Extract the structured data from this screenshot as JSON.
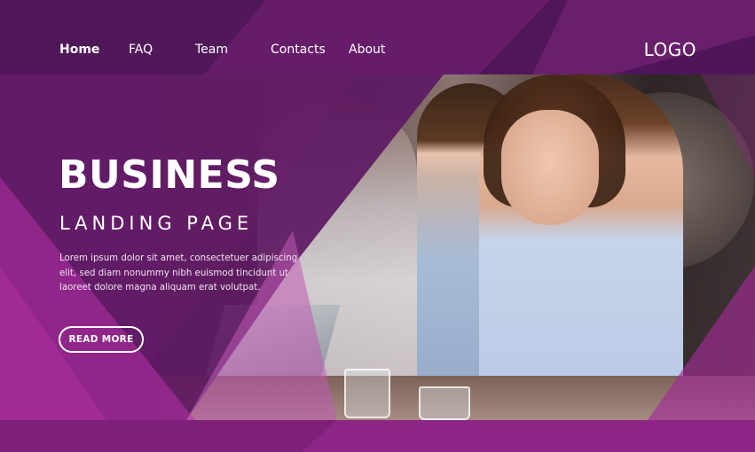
{
  "nav": {
    "items": [
      {
        "label": "Home",
        "active": true
      },
      {
        "label": "FAQ"
      },
      {
        "label": "Team"
      },
      {
        "label": "Contacts"
      },
      {
        "label": "About"
      }
    ],
    "logo": "LOGO"
  },
  "hero": {
    "title": "BUSINESS",
    "subtitle": "LANDING PAGE",
    "body": "Lorem ipsum dolor sit amet, consectetuer adipiscing elit, sed diam nonummy nibh euismod tincidunt ut laoreet dolore magna aliquam erat volutpat.",
    "button_label": "READ MORE"
  },
  "colors": {
    "primary_purple": "#6b1e6e",
    "accent_magenta": "#9a2a92",
    "text": "#ffffff"
  }
}
